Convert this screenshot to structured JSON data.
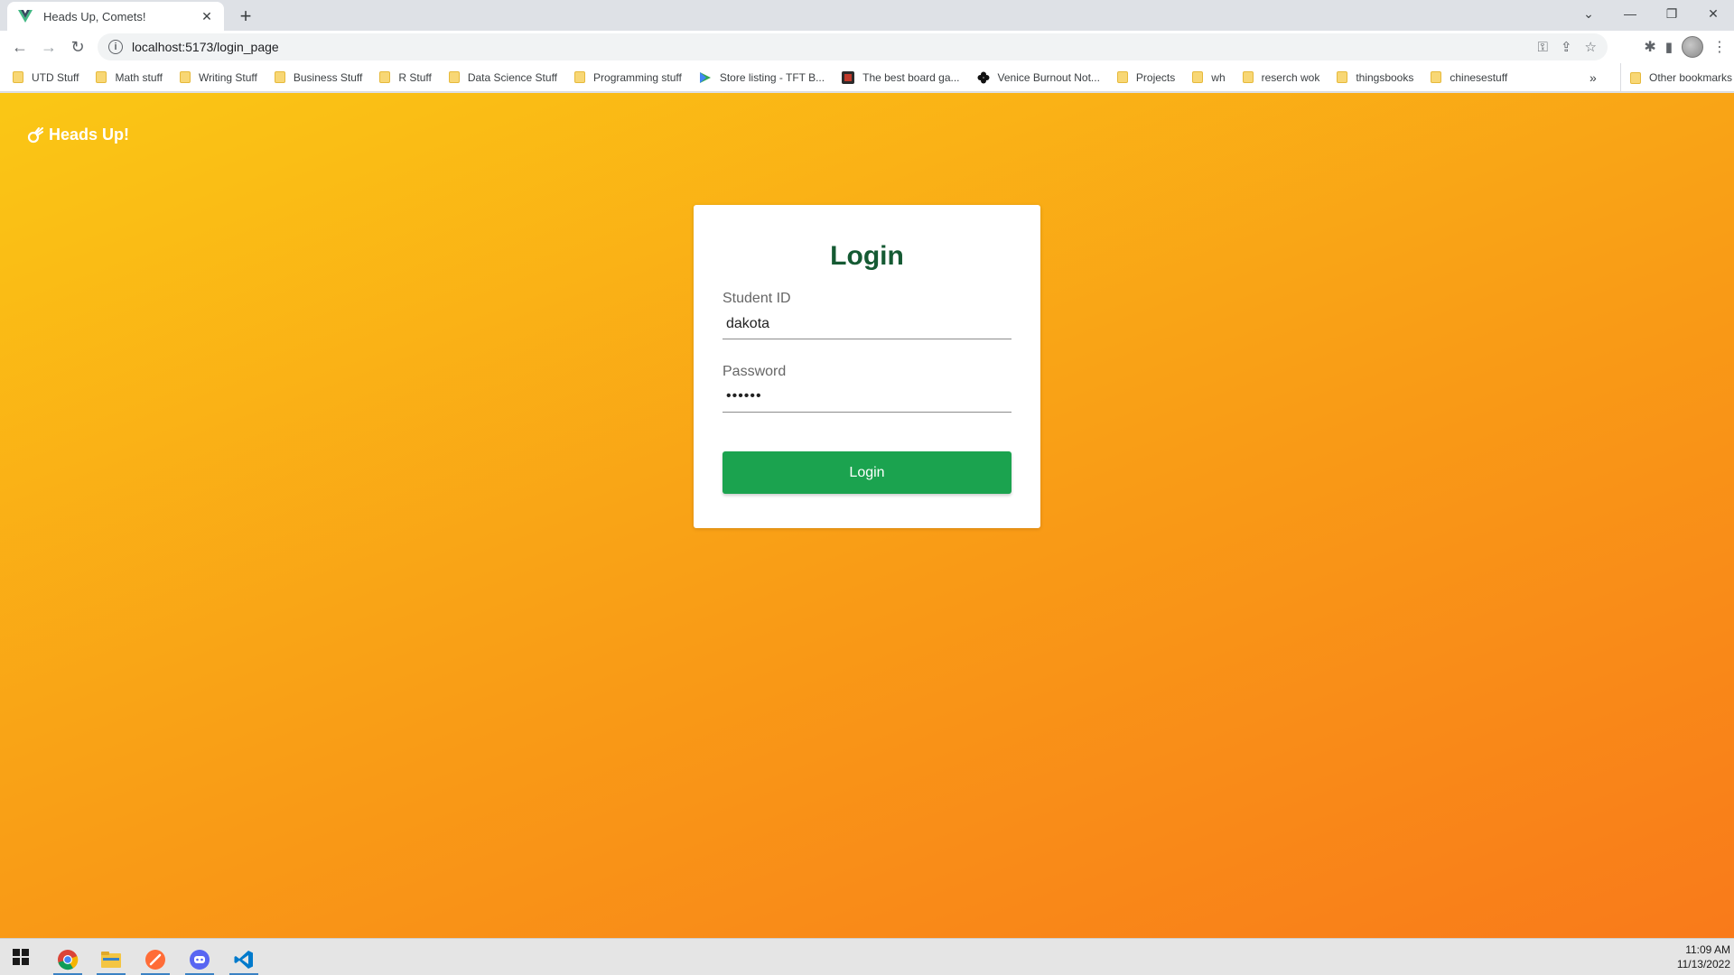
{
  "browser": {
    "tab_title": "Heads Up, Comets!",
    "url": "localhost:5173/login_page",
    "bookmarks": [
      {
        "label": "UTD Stuff",
        "icon": "folder-icon"
      },
      {
        "label": "Math stuff",
        "icon": "folder-icon"
      },
      {
        "label": "Writing Stuff",
        "icon": "folder-icon"
      },
      {
        "label": "Business Stuff",
        "icon": "folder-icon"
      },
      {
        "label": "R Stuff",
        "icon": "folder-icon"
      },
      {
        "label": "Data Science Stuff",
        "icon": "folder-icon"
      },
      {
        "label": "Programming stuff",
        "icon": "folder-icon"
      },
      {
        "label": "Store listing - TFT B...",
        "icon": "play-store-icon"
      },
      {
        "label": "The best board ga...",
        "icon": "site-icon"
      },
      {
        "label": "Venice Burnout Not...",
        "icon": "clover-icon"
      },
      {
        "label": "Projects",
        "icon": "folder-icon"
      },
      {
        "label": "wh",
        "icon": "folder-icon"
      },
      {
        "label": "reserch wok",
        "icon": "folder-icon"
      },
      {
        "label": "thingsbooks",
        "icon": "folder-icon"
      },
      {
        "label": "chinesestuff",
        "icon": "folder-icon"
      }
    ],
    "bookmarks_more": "»",
    "other_bookmarks": "Other bookmarks"
  },
  "app": {
    "brand": "Heads Up!",
    "login": {
      "title": "Login",
      "student_id_label": "Student ID",
      "student_id_value": "dakota",
      "password_label": "Password",
      "password_value": "••••••",
      "button_label": "Login"
    }
  },
  "taskbar": {
    "time": "11:09 AM",
    "date": "11/13/2022"
  },
  "colors": {
    "title_green": "#155a33",
    "button_green": "#1ba34f",
    "gradient_start": "#fac715",
    "gradient_end": "#f97a1a"
  }
}
